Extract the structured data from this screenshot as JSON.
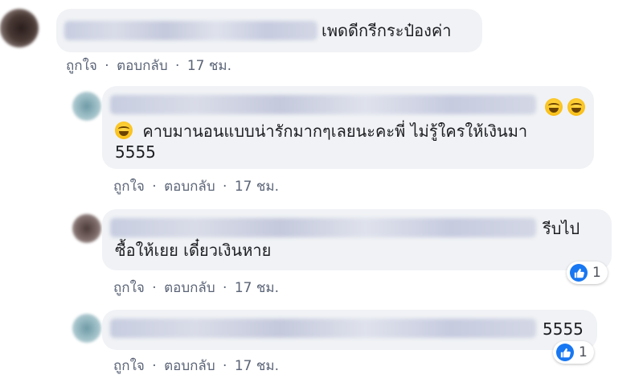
{
  "comments": [
    {
      "text": "เพดดีกรีกระป๋องค่า",
      "actions": {
        "like": "ถูกใจ",
        "reply": "ตอบกลับ",
        "time": "17 ชม."
      }
    },
    {
      "text_line1": "คาบมานอนแบบน่ารักมากๆเลยนะคะพี่ ไม่รู้ใครให้เงินมา",
      "text_line2": "5555",
      "emoji": "grinning-squinting-face",
      "actions": {
        "like": "ถูกใจ",
        "reply": "ตอบกลับ",
        "time": "17 ชม."
      }
    },
    {
      "text_line1": "รีบไป",
      "text_line2": "ซื้อให้เยย เดี๋ยวเงินหาย",
      "reaction_count": "1",
      "actions": {
        "like": "ถูกใจ",
        "reply": "ตอบกลับ",
        "time": "17 ชม."
      }
    },
    {
      "text": "5555",
      "reaction_count": "1",
      "actions": {
        "like": "ถูกใจ",
        "reply": "ตอบกลับ",
        "time": "17 ชม."
      }
    }
  ],
  "sep": "·",
  "colors": {
    "bubble": "#f0f2f5",
    "like_blue": "#1877f2",
    "action_text": "#5b6477"
  }
}
